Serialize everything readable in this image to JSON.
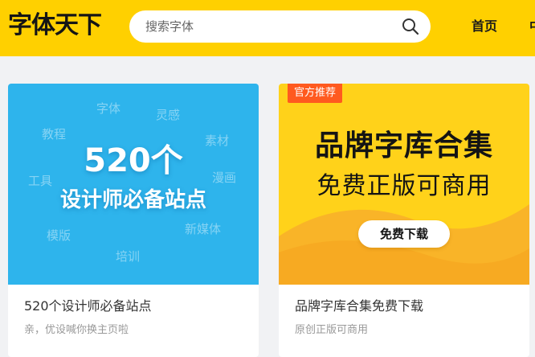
{
  "header": {
    "logo": "字体天下",
    "search_placeholder": "搜索字体",
    "search_icon": "search-icon",
    "nav": [
      "首页",
      "中"
    ],
    "background_color": "#ffd000"
  },
  "cards": [
    {
      "banner": {
        "headline": "520个",
        "subline": "设计师必备站点",
        "keywords": [
          "字体",
          "灵感",
          "教程",
          "素材",
          "工具",
          "漫画",
          "模版",
          "新媒体",
          "培训"
        ],
        "background_color": "#2eb4ec"
      },
      "title": "520个设计师必备站点",
      "description": "亲，优设喊你换主页啦"
    },
    {
      "banner": {
        "badge": "官方推荐",
        "line1": "品牌字库合集",
        "line2": "免费正版可商用",
        "button": "免费下载",
        "background_color": "#ffd21a",
        "badge_color": "#ff5a1f"
      },
      "title": "品牌字库合集免费下载",
      "description": "原创正版可商用"
    }
  ]
}
